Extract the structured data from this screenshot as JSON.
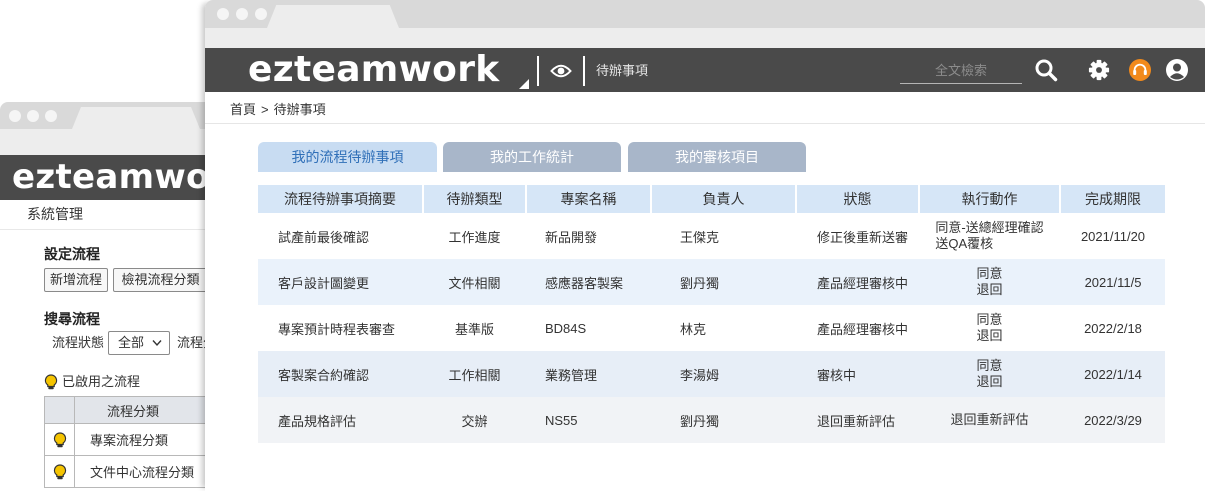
{
  "app": {
    "logo": "ezteamwork"
  },
  "back_window": {
    "menu_title": "系統管理",
    "setup": {
      "title": "設定流程",
      "add_button": "新增流程",
      "view_button": "檢視流程分類"
    },
    "search": {
      "title": "搜尋流程",
      "status_label": "流程狀態",
      "status_value": "全部",
      "next_label": "流程分"
    },
    "enabled": {
      "title": "已啟用之流程",
      "column_header": "流程分類",
      "rows": [
        "專案流程分類",
        "文件中心流程分類"
      ]
    }
  },
  "front_window": {
    "header": {
      "page_label": "待辦事項",
      "search_placeholder": "全文檢索"
    },
    "breadcrumb": {
      "home": "首頁",
      "separator": ">",
      "current": "待辦事項"
    },
    "tabs": [
      {
        "label": "我的流程待辦事項",
        "active": true
      },
      {
        "label": "我的工作統計",
        "active": false
      },
      {
        "label": "我的審核項目",
        "active": false
      }
    ],
    "table": {
      "columns": [
        "流程待辦事項摘要",
        "待辦類型",
        "專案名稱",
        "負責人",
        "狀態",
        "執行動作",
        "完成期限"
      ],
      "rows": [
        {
          "summary": "試產前最後確認",
          "type": "工作進度",
          "project": "新品開發",
          "owner": "王傑克",
          "status": "修正後重新送審",
          "actions": [
            "同意-送總經理確認",
            "送QA覆核"
          ],
          "due": "2021/11/20"
        },
        {
          "summary": "客戶設計圖變更",
          "type": "文件相關",
          "project": "感應器客製案",
          "owner": "劉丹獨",
          "status": "產品經理審核中",
          "actions": [
            "同意",
            "退回"
          ],
          "due": "2021/11/5"
        },
        {
          "summary": "專案預計時程表審查",
          "type": "基準版",
          "project": "BD84S",
          "owner": "林克",
          "status": "產品經理審核中",
          "actions": [
            "同意",
            "退回"
          ],
          "due": "2022/2/18"
        },
        {
          "summary": "客製案合約確認",
          "type": "工作相關",
          "project": "業務管理",
          "owner": "李湯姆",
          "status": "審核中",
          "actions": [
            "同意",
            "退回"
          ],
          "due": "2022/1/14"
        },
        {
          "summary": "產品規格評估",
          "type": "交辦",
          "project": "NS55",
          "owner": "劉丹獨",
          "status": "退回重新評估",
          "actions": [
            "退回重新評估"
          ],
          "due": "2022/3/29"
        }
      ]
    }
  },
  "icons": [
    "collapse-triangle-icon",
    "eye-icon",
    "search-icon",
    "gear-icon",
    "headset-icon",
    "user-icon",
    "lightbulb-icon",
    "chevron-down-icon"
  ],
  "colors": {
    "header_bar": "#4a4a4a",
    "tab_active_bg": "#c8dcf2",
    "tab_active_text": "#2f6fb8",
    "tab_inactive_bg": "#a8b6c9",
    "table_header_bg": "#d6e6f7",
    "row_alt_bg": "#eaf2fb",
    "headset_accent": "#f28a1b",
    "bulb": "#f5c400"
  }
}
